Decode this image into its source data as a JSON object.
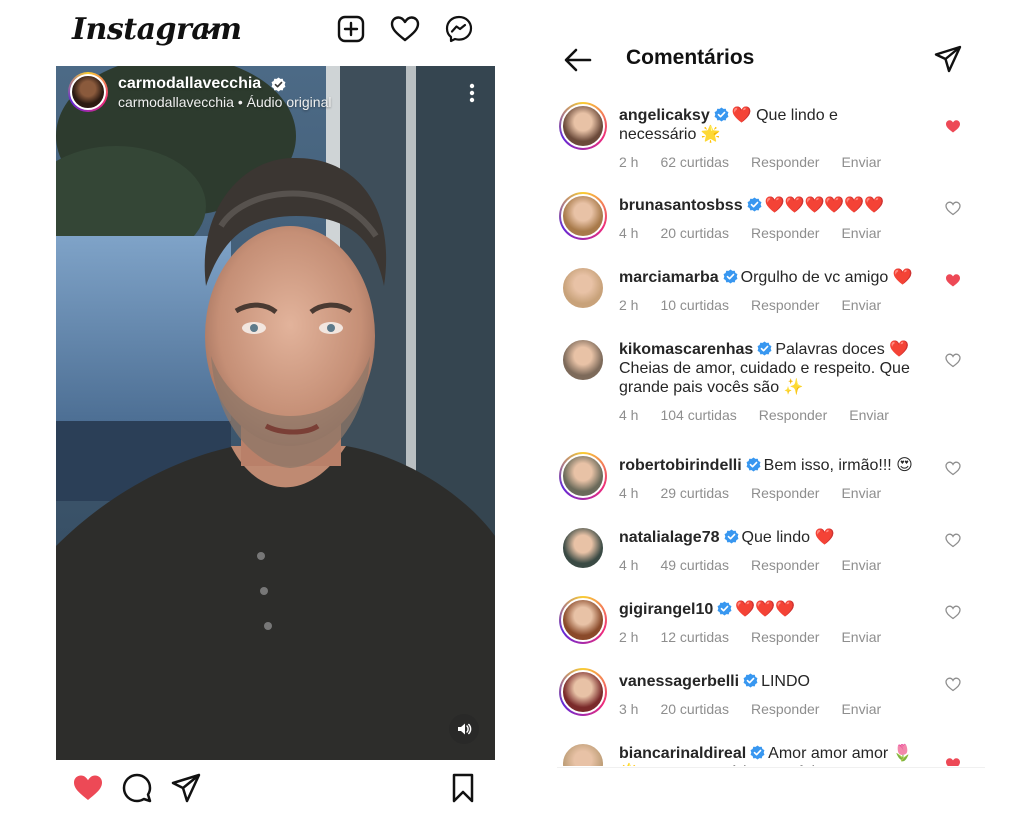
{
  "app": {
    "logo_text": "Instagram"
  },
  "post": {
    "username": "carmodallavecchia",
    "subtitle": "carmodallavecchia • Áudio original",
    "liked": true
  },
  "comments_panel": {
    "title": "Comentários",
    "comments": [
      {
        "user": "angelicaksy",
        "text": "❤️ Que lindo e necessário 🌟",
        "time": "2 h",
        "likes": "62 curtidas",
        "reply": "Responder",
        "send": "Enviar",
        "liked": true,
        "avatar_color": "#6b4a3a"
      },
      {
        "user": "brunasantosbss",
        "text": "❤️❤️❤️❤️❤️❤️",
        "time": "4 h",
        "likes": "20 curtidas",
        "reply": "Responder",
        "send": "Enviar",
        "liked": false,
        "avatar_color": "#a87a4a"
      },
      {
        "user": "marciamarba",
        "text": "Orgulho de vc amigo ❤️",
        "time": "2 h",
        "likes": "10 curtidas",
        "reply": "Responder",
        "send": "Enviar",
        "liked": true,
        "avatar_color": "#c8a27a"
      },
      {
        "user": "kikomascarenhas",
        "text": "Palavras doces ❤️ Cheias de amor, cuidado e respeito. Que grande pais vocês são ✨",
        "time": "4 h",
        "likes": "104 curtidas",
        "reply": "Responder",
        "send": "Enviar",
        "liked": false,
        "avatar_color": "#7d6a5a"
      },
      {
        "user": "robertobirindelli",
        "text": "Bem isso, irmão!!! 😍",
        "time": "4 h",
        "likes": "29 curtidas",
        "reply": "Responder",
        "send": "Enviar",
        "liked": false,
        "avatar_color": "#6a6a5a"
      },
      {
        "user": "natalialage78",
        "text": "Que lindo ❤️",
        "time": "4 h",
        "likes": "49 curtidas",
        "reply": "Responder",
        "send": "Enviar",
        "liked": false,
        "avatar_color": "#3a4a44"
      },
      {
        "user": "gigirangel10",
        "text": "❤️❤️❤️",
        "time": "2 h",
        "likes": "12 curtidas",
        "reply": "Responder",
        "send": "Enviar",
        "liked": false,
        "avatar_color": "#8a4a2a"
      },
      {
        "user": "vanessagerbelli",
        "text": "LINDO",
        "time": "3 h",
        "likes": "20 curtidas",
        "reply": "Responder",
        "send": "Enviar",
        "liked": false,
        "avatar_color": "#7a2a2a"
      },
      {
        "user": "biancarinaldireal",
        "text": "Amor amor amor 🌷🌟 Que necessário essa fala Carmo, obrigada",
        "time": "",
        "likes": "",
        "reply": "",
        "send": "",
        "liked": true,
        "avatar_color": "#c0a07a"
      }
    ]
  },
  "colors": {
    "like_red": "#ed4956",
    "verified_blue": "#3897f0",
    "meta_gray": "#8e8e8e"
  },
  "icons": [
    "chevron-down-icon",
    "new-post-icon",
    "heart-icon",
    "messenger-icon",
    "more-icon",
    "volume-icon",
    "comment-icon",
    "share-icon",
    "bookmark-icon",
    "back-arrow-icon",
    "verified-icon"
  ]
}
